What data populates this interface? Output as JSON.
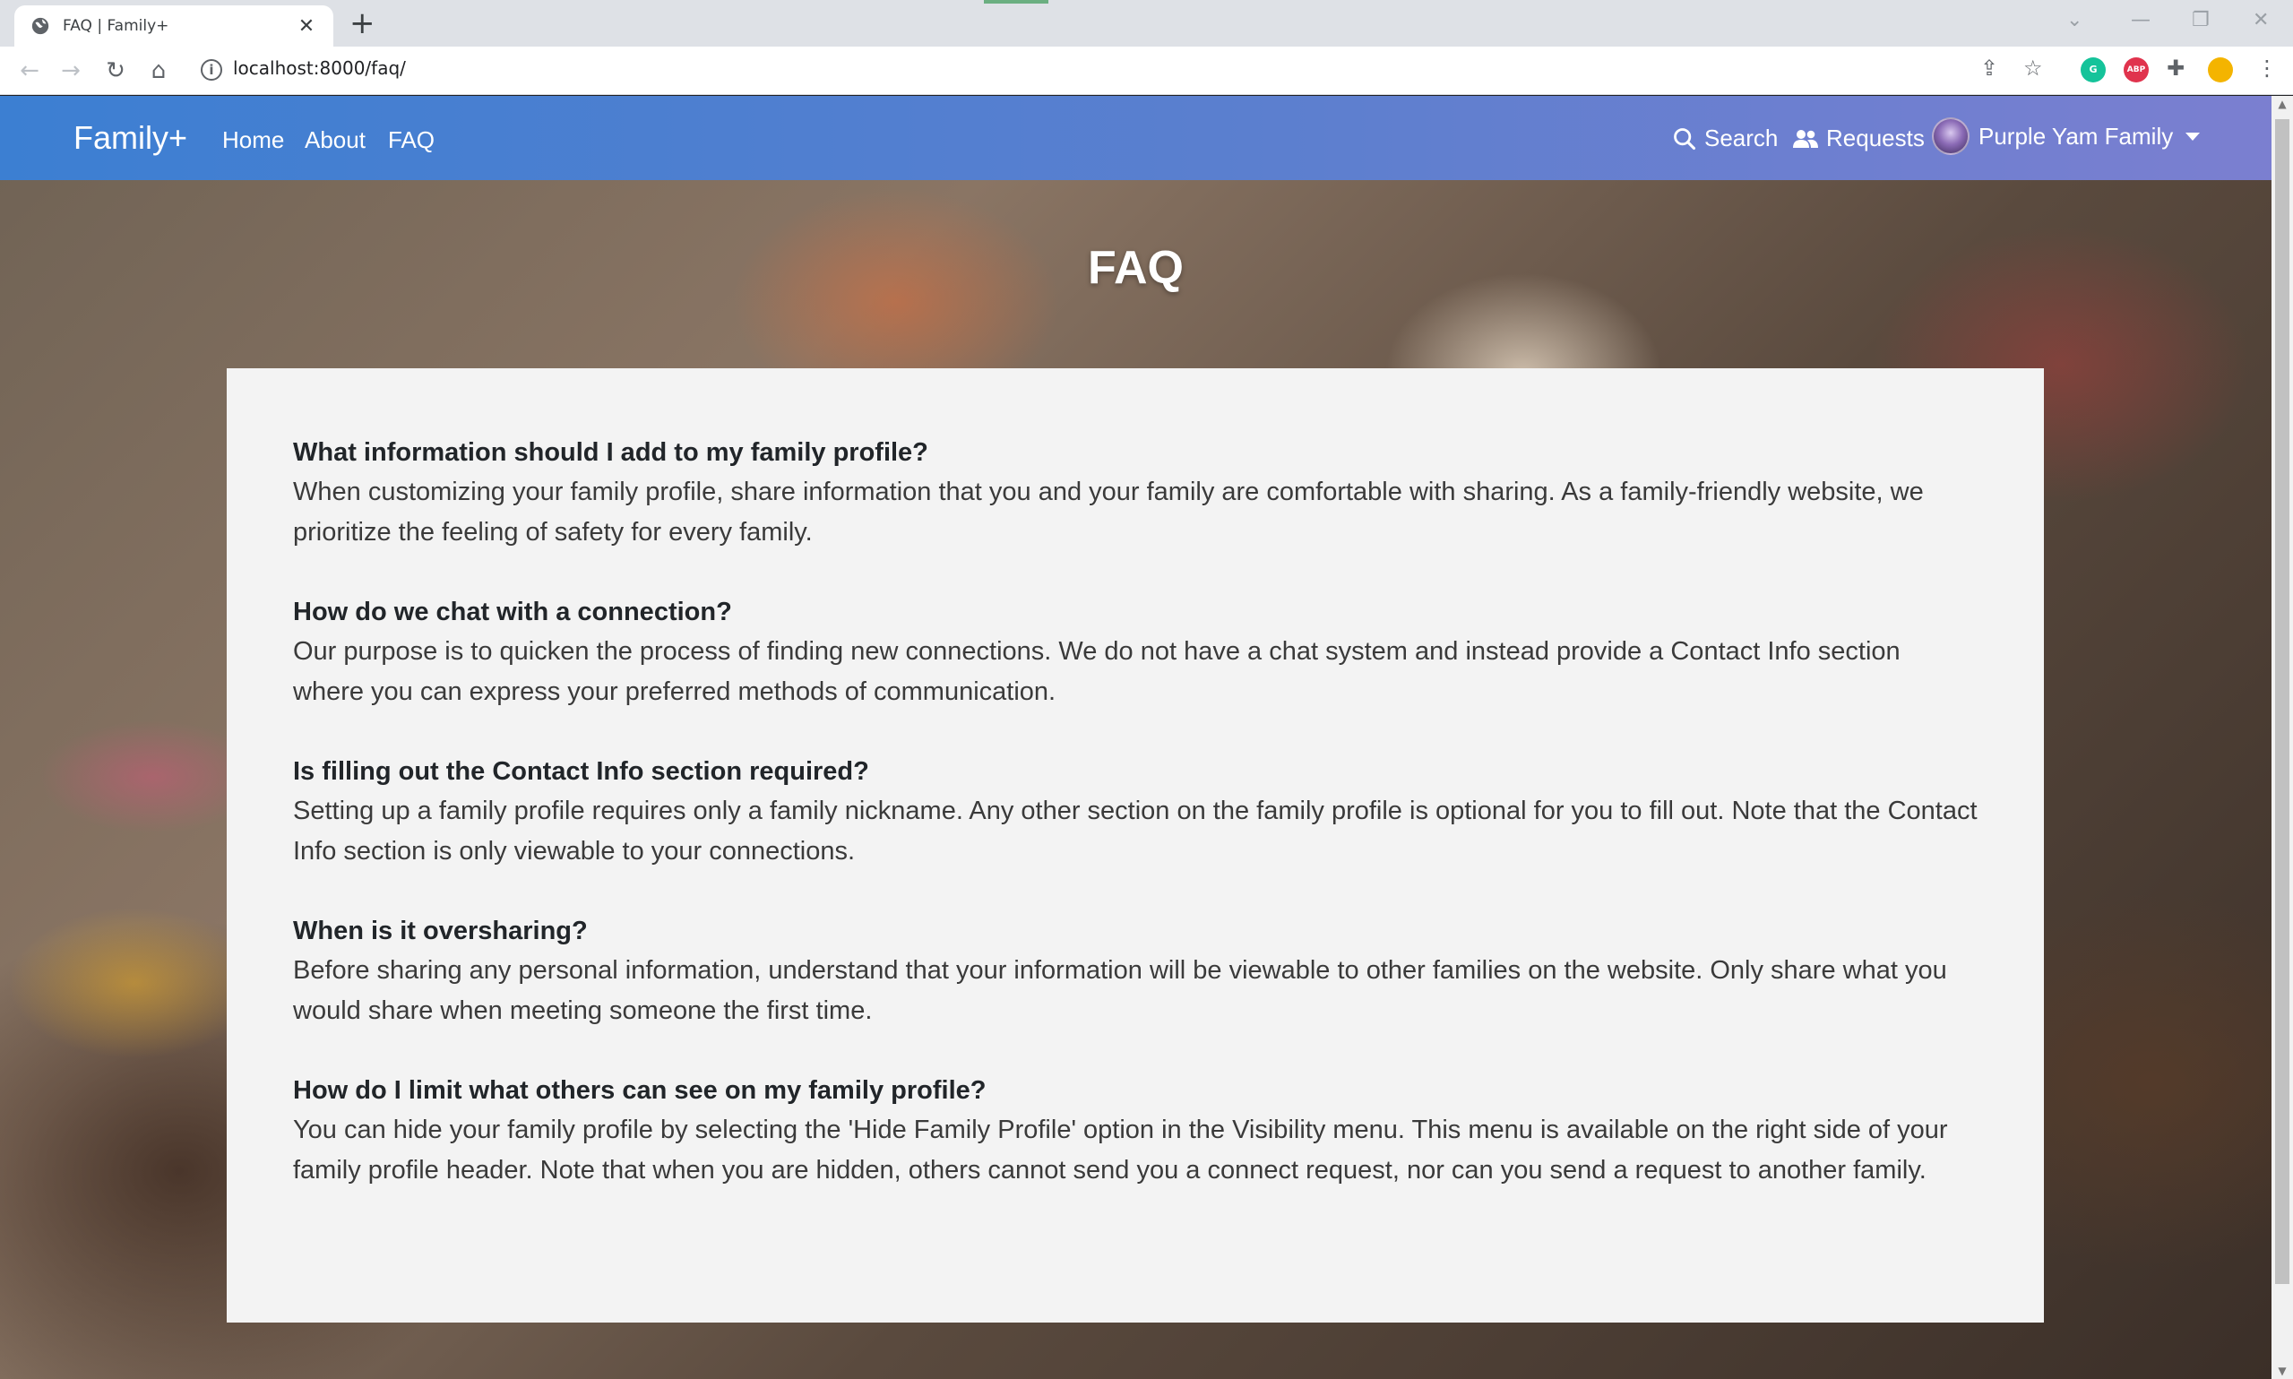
{
  "browser": {
    "tab_title": "FAQ | Family+",
    "tab_close": "✕",
    "new_tab": "+",
    "url": "localhost:8000/faq/",
    "ext_grammarly": "G",
    "ext_abp": "ABP"
  },
  "navbar": {
    "brand": "Family+",
    "links": [
      "Home",
      "About",
      "FAQ"
    ],
    "search": "Search",
    "requests": "Requests",
    "account": "Purple Yam Family"
  },
  "page": {
    "title": "FAQ",
    "faqs": [
      {
        "q": "What information should I add to my family profile?",
        "a": "When customizing your family profile, share information that you and your family are comfortable with sharing. As a family-friendly website, we prioritize the feeling of safety for every family."
      },
      {
        "q": "How do we chat with a connection?",
        "a": "Our purpose is to quicken the process of finding new connections. We do not have a chat system and instead provide a Contact Info section where you can express your preferred methods of communication."
      },
      {
        "q": "Is filling out the Contact Info section required?",
        "a": "Setting up a family profile requires only a family nickname. Any other section on the family profile is optional for you to fill out. Note that the Contact Info section is only viewable to your connections."
      },
      {
        "q": "When is it oversharing?",
        "a": "Before sharing any personal information, understand that your information will be viewable to other families on the website. Only share what you would share when meeting someone the first time."
      },
      {
        "q": "How do I limit what others can see on my family profile?",
        "a": "You can hide your family profile by selecting the 'Hide Family Profile' option in the Visibility menu. This menu is available on the right side of your family profile header. Note that when you are hidden, others cannot send you a connect request, nor can you send a request to another family."
      }
    ]
  },
  "colors": {
    "navbar_start": "#3c7fd2",
    "navbar_end": "#7b7fd0",
    "card_bg": "#f3f3f3"
  }
}
